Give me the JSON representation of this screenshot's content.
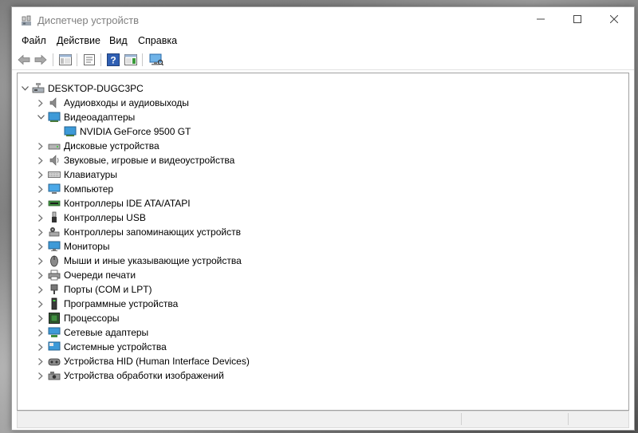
{
  "window": {
    "title": "Диспетчер устройств"
  },
  "menu": [
    "Файл",
    "Действие",
    "Вид",
    "Справка"
  ],
  "toolbar": {
    "buttons": [
      "back-icon",
      "forward-icon",
      "show-hide-console-tree-icon",
      "properties-icon",
      "help-icon",
      "action-pane-icon",
      "scan-hardware-icon"
    ]
  },
  "tree": {
    "root": "DESKTOP-DUGC3PC",
    "categories": [
      {
        "label": "Аудиовходы и аудиовыходы",
        "icon": "speaker-icon",
        "expanded": false
      },
      {
        "label": "Видеоадаптеры",
        "icon": "display-adapter-icon",
        "expanded": true,
        "children": [
          "NVIDIA GeForce 9500 GT"
        ]
      },
      {
        "label": "Дисковые устройства",
        "icon": "disk-drive-icon",
        "expanded": false
      },
      {
        "label": "Звуковые, игровые и видеоустройства",
        "icon": "sound-icon",
        "expanded": false
      },
      {
        "label": "Клавиатуры",
        "icon": "keyboard-icon",
        "expanded": false
      },
      {
        "label": "Компьютер",
        "icon": "computer-icon",
        "expanded": false
      },
      {
        "label": "Контроллеры IDE ATA/ATAPI",
        "icon": "ide-controller-icon",
        "expanded": false
      },
      {
        "label": "Контроллеры USB",
        "icon": "usb-icon",
        "expanded": false
      },
      {
        "label": "Контроллеры запоминающих устройств",
        "icon": "storage-controller-icon",
        "expanded": false
      },
      {
        "label": "Мониторы",
        "icon": "monitor-icon",
        "expanded": false
      },
      {
        "label": "Мыши и иные указывающие устройства",
        "icon": "mouse-icon",
        "expanded": false
      },
      {
        "label": "Очереди печати",
        "icon": "printer-icon",
        "expanded": false
      },
      {
        "label": "Порты (COM и LPT)",
        "icon": "port-icon",
        "expanded": false
      },
      {
        "label": "Программные устройства",
        "icon": "software-device-icon",
        "expanded": false
      },
      {
        "label": "Процессоры",
        "icon": "processor-icon",
        "expanded": false
      },
      {
        "label": "Сетевые адаптеры",
        "icon": "network-adapter-icon",
        "expanded": false
      },
      {
        "label": "Системные устройства",
        "icon": "system-device-icon",
        "expanded": false
      },
      {
        "label": "Устройства HID (Human Interface Devices)",
        "icon": "hid-icon",
        "expanded": false
      },
      {
        "label": "Устройства обработки изображений",
        "icon": "imaging-device-icon",
        "expanded": false
      }
    ]
  },
  "colors": {
    "accent_blue": "#1e78c8",
    "chevron": "#707070",
    "title_gray": "#808080"
  }
}
